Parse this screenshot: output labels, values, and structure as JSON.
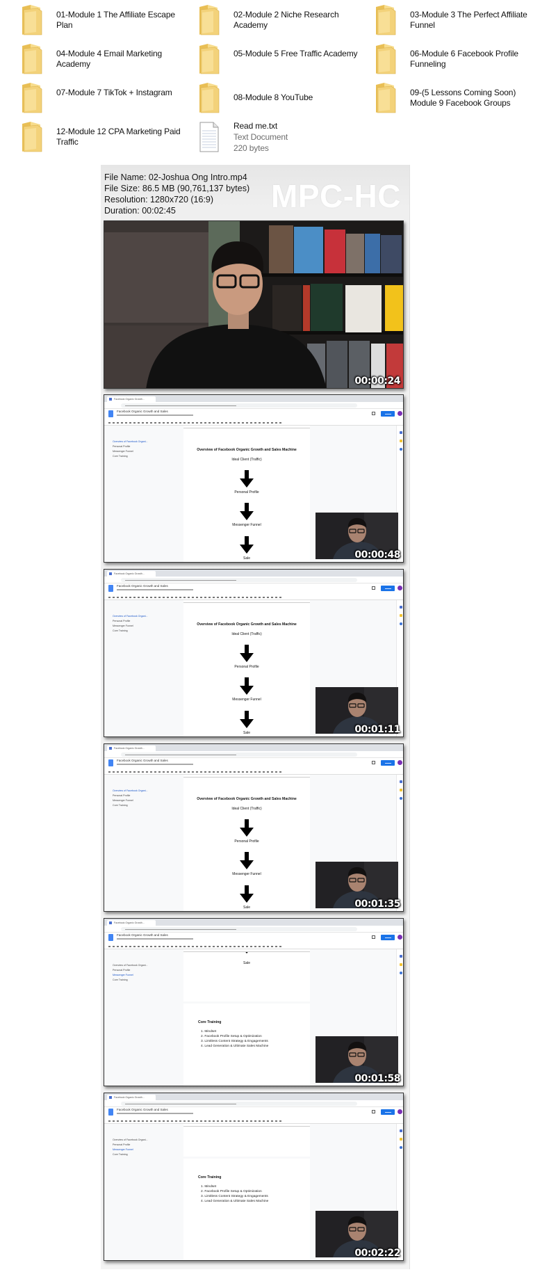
{
  "explorer": {
    "items": [
      {
        "name": "01-Module 1 The Affiliate Escape Plan",
        "type": "folder"
      },
      {
        "name": "02-Module 2  Niche Research Academy",
        "type": "folder"
      },
      {
        "name": "03-Module 3 The Perfect Affiliate Funnel",
        "type": "folder"
      },
      {
        "name": "04-Module 4  Email Marketing Academy",
        "type": "folder"
      },
      {
        "name": "05-Module 5  Free Traffic Academy",
        "type": "folder"
      },
      {
        "name": "06-Module 6  Facebook Profile Funneling",
        "type": "folder"
      },
      {
        "name": "07-Module 7  TikTok + Instagram",
        "type": "folder"
      },
      {
        "name": "08-Module 8  YouTube",
        "type": "folder"
      },
      {
        "name": "09-(5 Lessons Coming Soon) Module 9  Facebook Groups",
        "type": "folder"
      },
      {
        "name": "12-Module 12 CPA Marketing Paid Traffic",
        "type": "folder"
      },
      {
        "name": "Read me.txt",
        "type": "text-file",
        "kind": "Text Document",
        "size": "220 bytes"
      }
    ]
  },
  "mpc": {
    "logo": "MPC-HC",
    "file_name": "File Name: 02-Joshua Ong Intro.mp4",
    "file_size": "File Size: 86.5 MB (90,761,137 bytes)",
    "resolution": "Resolution: 1280x720 (16:9)",
    "duration": "Duration: 00:02:45",
    "video_timestamp": "00:00:24"
  },
  "doc": {
    "tab_title": "Facebook Organic Growth...",
    "title": "Facebook Organic Growth and Sales",
    "outline": [
      "Overview of Facebook Organi...",
      "Personal Profile",
      "Messenger Funnel",
      "Core Training"
    ],
    "heading": "Overview of Facebook Organic Growth and Sales Machine",
    "flow": [
      "Ideal Client (Traffic)",
      "Personal Profile",
      "Messenger Funnel",
      "Sale"
    ],
    "core_title": "Core Training",
    "core_items": [
      "1. Mindset",
      "2. Facebook Profile Setup & Optimization",
      "3. Limitless Content Strategy & Engagements",
      "4. Lead Generation & Ultimate Sales Machine"
    ]
  },
  "frames": [
    {
      "timestamp": "00:00:48",
      "view": "flow",
      "outline_active": 0
    },
    {
      "timestamp": "00:01:11",
      "view": "flow",
      "outline_active": 0
    },
    {
      "timestamp": "00:01:35",
      "view": "flow",
      "outline_active": 0
    },
    {
      "timestamp": "00:01:58",
      "view": "sale-core",
      "outline_active": 2
    },
    {
      "timestamp": "00:02:22",
      "view": "core",
      "outline_active": 2
    }
  ],
  "colors": {
    "folder": "#f3d27a",
    "share_button": "#1a73e8",
    "avatar": "#7b2fb5",
    "panel": "#eeeeee"
  }
}
